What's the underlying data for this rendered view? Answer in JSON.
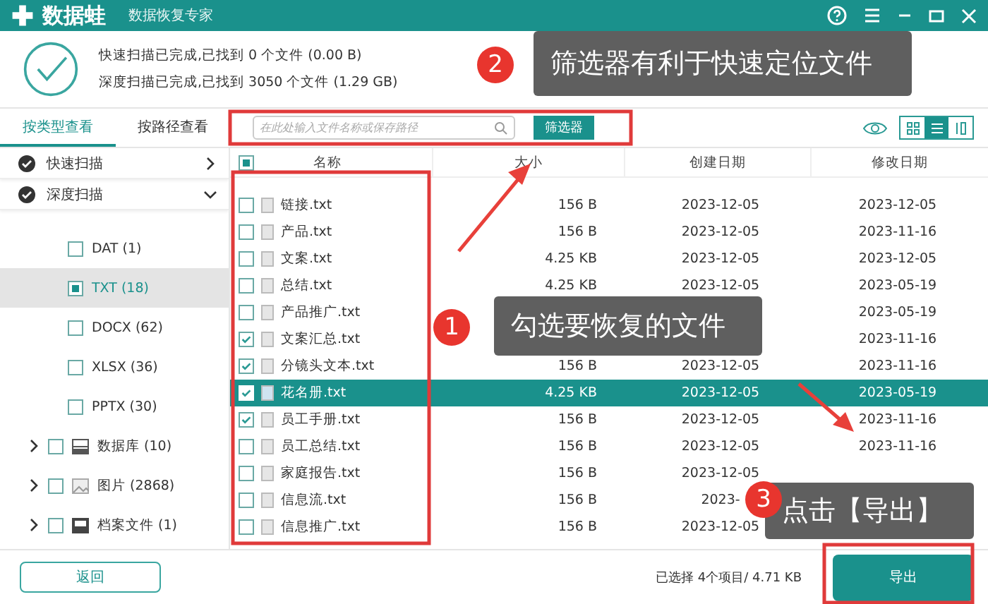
{
  "window": {
    "app_name": "数据蛙",
    "subtitle": "数据恢复专家"
  },
  "scan_status": [
    "快速扫描已完成,已找到 0 个文件 (0.00  B)",
    "深度扫描已完成,已找到 3050 个文件 (1.29 GB)"
  ],
  "tabs": [
    {
      "label": "按类型查看",
      "selected": true
    },
    {
      "label": "按路径查看",
      "selected": false
    }
  ],
  "search": {
    "placeholder": "在此处输入文件名称或保存路径"
  },
  "filter_button": "筛选器",
  "view_modes": [
    {
      "kind": "grid",
      "selected": false
    },
    {
      "kind": "list",
      "selected": true
    },
    {
      "kind": "detail",
      "selected": false
    }
  ],
  "sidebar": {
    "scans": [
      {
        "label": "快速扫描",
        "expanded": false
      },
      {
        "label": "深度扫描",
        "expanded": true
      }
    ],
    "items": [
      {
        "kind": "type",
        "label": "DAT (1)",
        "partial": false,
        "selected": false
      },
      {
        "kind": "type",
        "label": "TXT (18)",
        "partial": true,
        "selected": true
      },
      {
        "kind": "type",
        "label": "DOCX (62)",
        "partial": false,
        "selected": false
      },
      {
        "kind": "type",
        "label": "XLSX (36)",
        "partial": false,
        "selected": false
      },
      {
        "kind": "type",
        "label": "PPTX (30)",
        "partial": false,
        "selected": false
      },
      {
        "kind": "database",
        "label": "数据库 (10)",
        "partial": false,
        "selected": false,
        "expanded": false
      },
      {
        "kind": "image",
        "label": "图片 (2868)",
        "partial": false,
        "selected": false,
        "expanded": false
      },
      {
        "kind": "archive",
        "label": "档案文件 (1)",
        "partial": false,
        "selected": false,
        "expanded": false
      }
    ]
  },
  "table": {
    "columns": [
      "名称",
      "大小",
      "创建日期",
      "修改日期"
    ],
    "all_partial": true,
    "rows": [
      {
        "name": "链接.txt",
        "size": "156  B",
        "created": "2023-12-05",
        "modified": "2023-12-05",
        "checked": false,
        "selected": false
      },
      {
        "name": "产品.txt",
        "size": "156  B",
        "created": "2023-12-05",
        "modified": "2023-11-16",
        "checked": false,
        "selected": false
      },
      {
        "name": "文案.txt",
        "size": "4.25 KB",
        "created": "2023-12-05",
        "modified": "2023-12-05",
        "checked": false,
        "selected": false
      },
      {
        "name": "总结.txt",
        "size": "4.25 KB",
        "created": "2023-12-05",
        "modified": "2023-05-19",
        "checked": false,
        "selected": false
      },
      {
        "name": "产品推广.txt",
        "modified": "2023-05-19",
        "checked": false,
        "selected": false
      },
      {
        "name": "文案汇总.txt",
        "modified": "2023-11-16",
        "checked": true,
        "selected": false
      },
      {
        "name": "分镜头文本.txt",
        "size": "156  B",
        "created": "2023-12-05",
        "modified": "2023-11-16",
        "checked": true,
        "selected": false
      },
      {
        "name": "花名册.txt",
        "size": "4.25 KB",
        "created": "2023-12-05",
        "modified": "2023-05-19",
        "checked": true,
        "selected": true
      },
      {
        "name": "员工手册.txt",
        "size": "156  B",
        "created": "2023-12-05",
        "modified": "2023-11-16",
        "checked": true,
        "selected": false
      },
      {
        "name": "员工总结.txt",
        "size": "156  B",
        "created": "2023-12-05",
        "modified": "2023-11-16",
        "checked": false,
        "selected": false
      },
      {
        "name": "家庭报告.txt",
        "size": "156  B",
        "created": "2023-12-05",
        "checked": false,
        "selected": false
      },
      {
        "name": "信息流.txt",
        "size": "156  B",
        "created": "2023-",
        "checked": false,
        "selected": false
      },
      {
        "name": "信息推广.txt",
        "size": "156  B",
        "created": "2023-12-05",
        "checked": false,
        "selected": false
      }
    ]
  },
  "footer": {
    "back_button": "返回",
    "selection_summary": "已选择 4个项目/ 4.71 KB",
    "export_button": "导出"
  },
  "annotations": [
    {
      "number": "2",
      "text": "筛选器有利于快速定位文件"
    },
    {
      "number": "1",
      "text": "勾选要恢复的文件"
    },
    {
      "number": "3",
      "text": "点击【导出】"
    }
  ]
}
